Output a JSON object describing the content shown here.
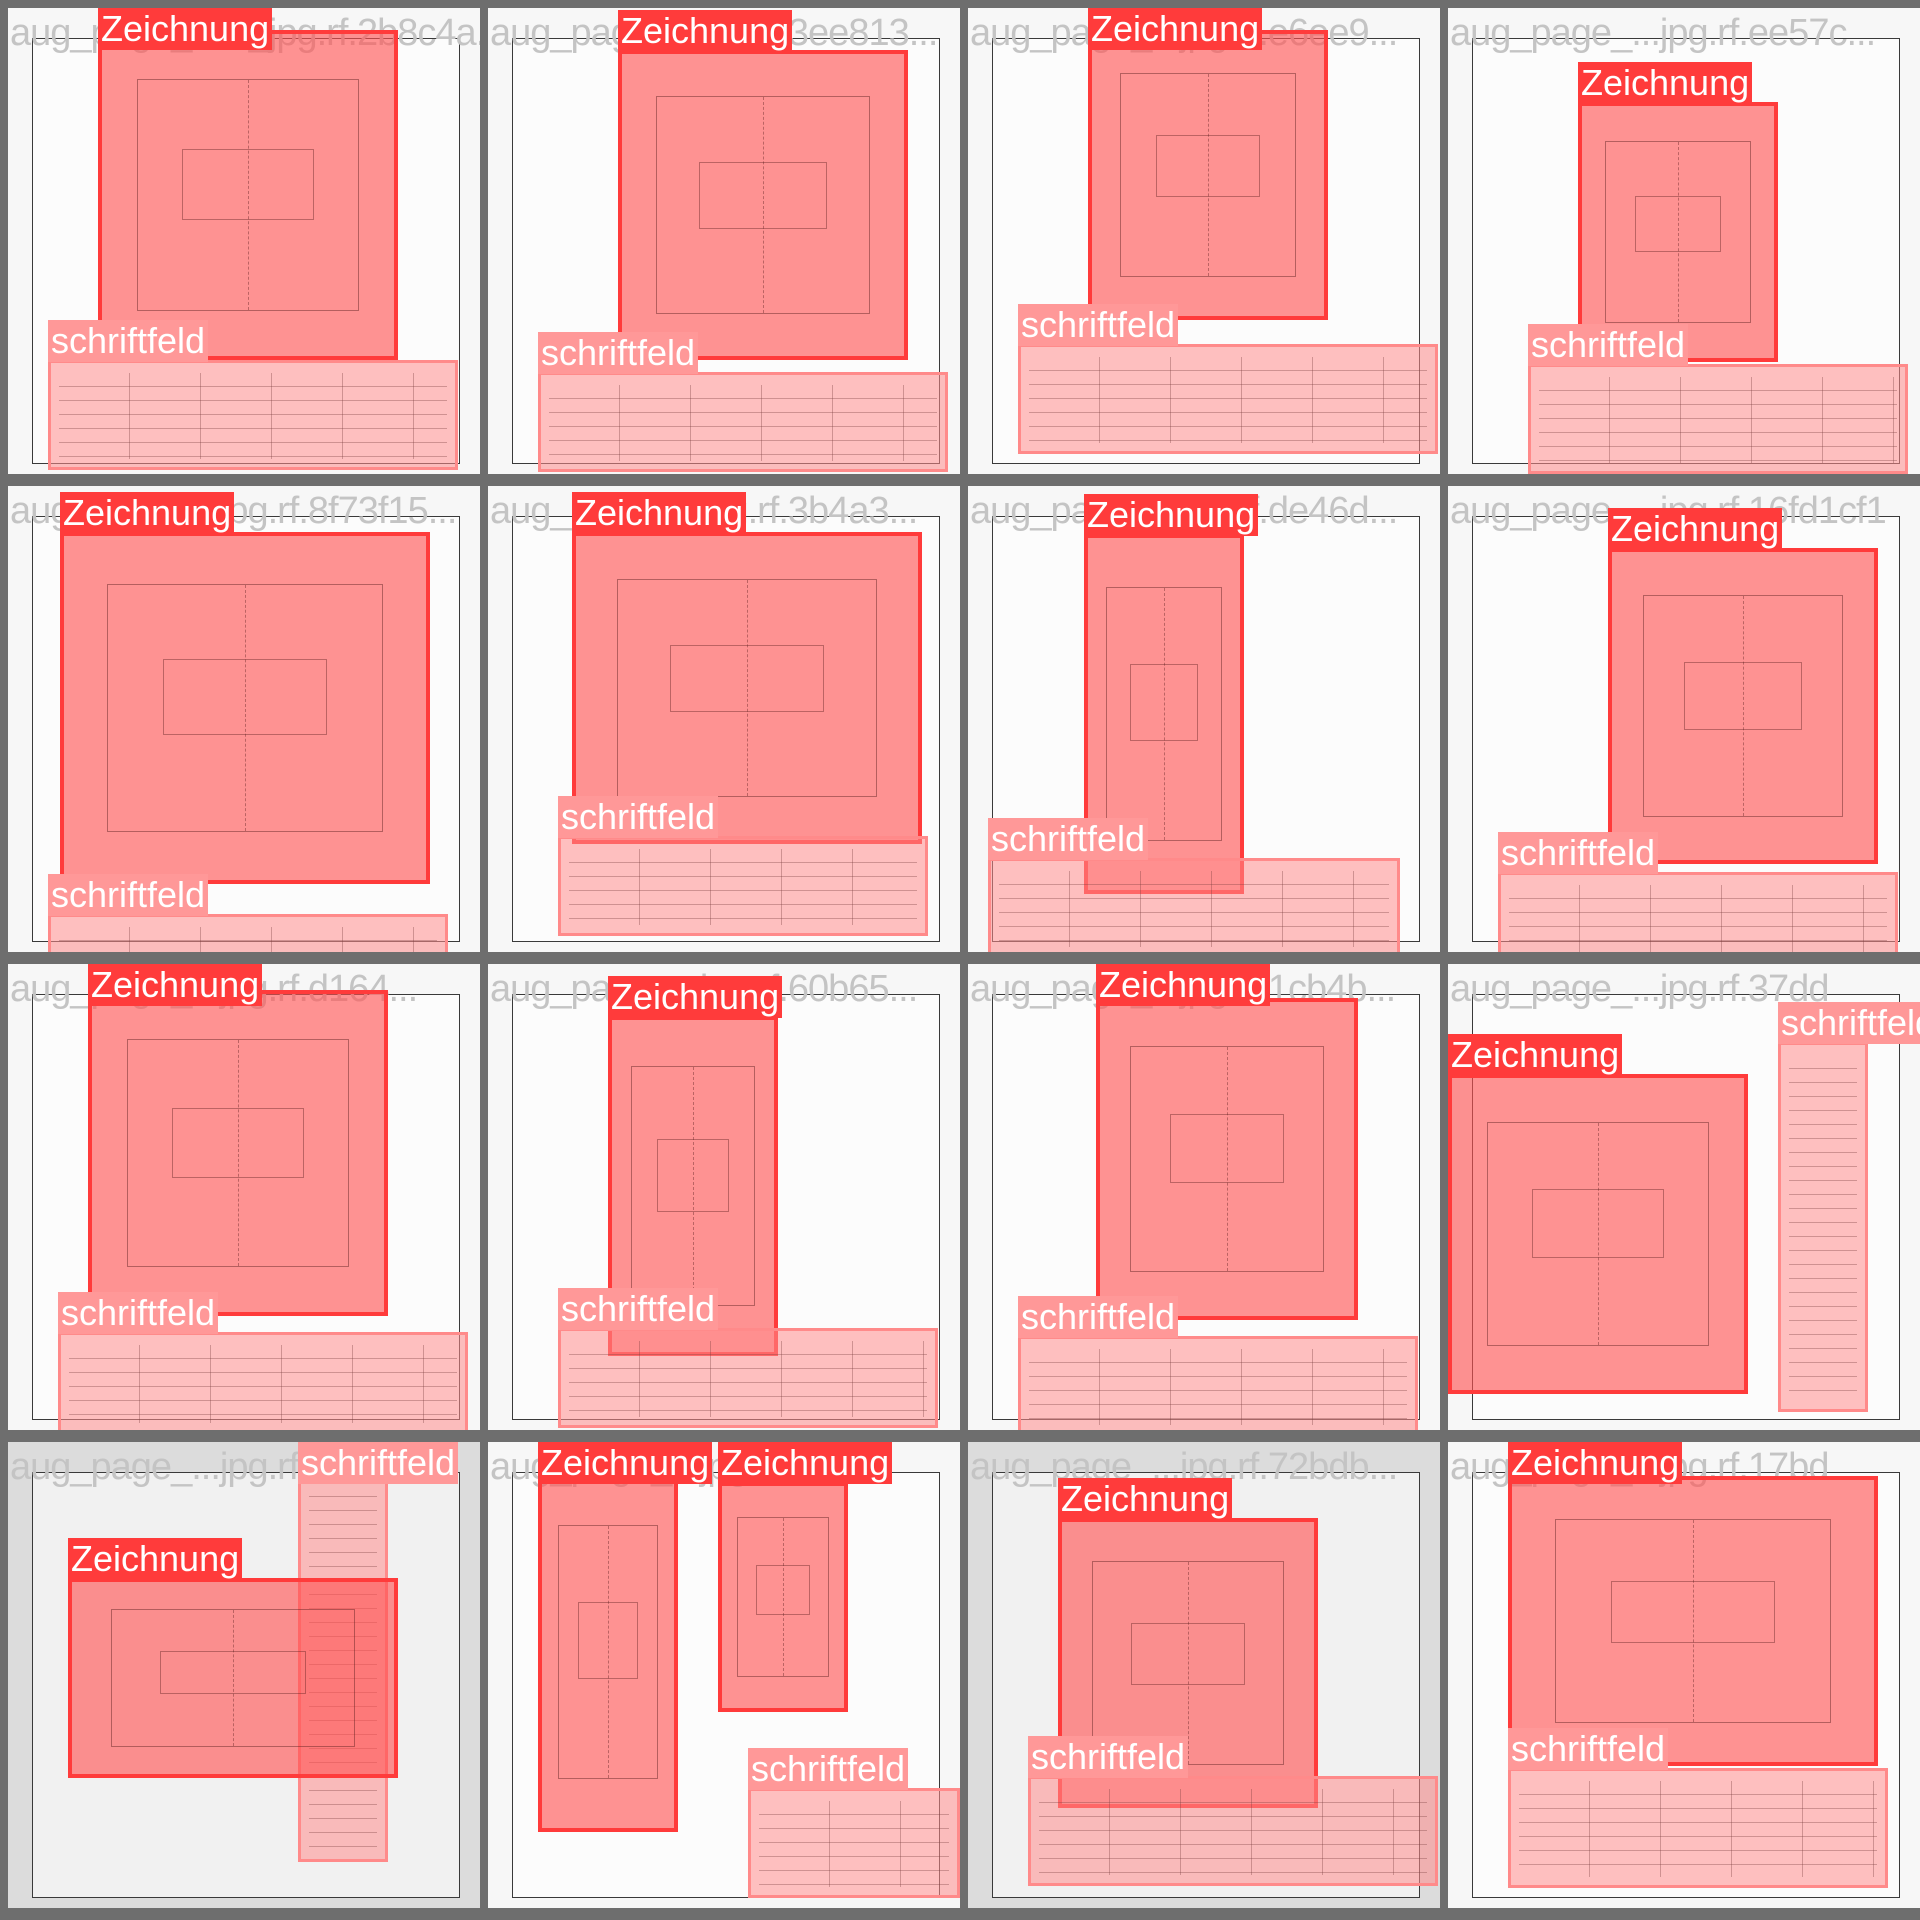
{
  "tiles": [
    {
      "fname": "aug_page_116_jpg.rf.2b8c4a...",
      "boxes": [
        {
          "cls": "z",
          "label": "Zeichnung"
        },
        {
          "cls": "s",
          "label": "schriftfeld"
        }
      ]
    },
    {
      "fname": "aug_page_...jpg.rf.3ee813...",
      "boxes": [
        {
          "cls": "z",
          "label": "Zeichnung"
        },
        {
          "cls": "s",
          "label": "schriftfeld"
        }
      ]
    },
    {
      "fname": "aug_page_...jpg.rf.e6ee9...",
      "boxes": [
        {
          "cls": "z",
          "label": "Zeichnung"
        },
        {
          "cls": "s",
          "label": "schriftfeld"
        }
      ]
    },
    {
      "fname": "aug_page_...jpg.rf.ee57c...",
      "boxes": [
        {
          "cls": "z",
          "label": "Zeichnung"
        },
        {
          "cls": "s",
          "label": "schriftfeld"
        }
      ]
    },
    {
      "fname": "aug_page_...jpg.rf.8f73f15...",
      "boxes": [
        {
          "cls": "z",
          "label": "Zeichnung"
        },
        {
          "cls": "s",
          "label": "schriftfeld"
        }
      ]
    },
    {
      "fname": "aug_page_...jpg.rf.3b4a3...",
      "boxes": [
        {
          "cls": "z",
          "label": "Zeichnung"
        },
        {
          "cls": "s",
          "label": "schriftfeld"
        }
      ]
    },
    {
      "fname": "aug_page_...jpg.rf.de46d...",
      "boxes": [
        {
          "cls": "z",
          "label": "Zeichnung"
        },
        {
          "cls": "s",
          "label": "schriftfeld"
        }
      ]
    },
    {
      "fname": "aug_page_...jpg.rf.16fd1cf1",
      "boxes": [
        {
          "cls": "z",
          "label": "Zeichnung"
        },
        {
          "cls": "s",
          "label": "schriftfeld"
        }
      ]
    },
    {
      "fname": "aug_page_...jpg.rf.d164...",
      "boxes": [
        {
          "cls": "z",
          "label": "Zeichnung"
        },
        {
          "cls": "s",
          "label": "schriftfeld"
        }
      ]
    },
    {
      "fname": "aug_page_...jpg.rf.60b65...",
      "boxes": [
        {
          "cls": "z",
          "label": "Zeichnung"
        },
        {
          "cls": "s",
          "label": "schriftfeld"
        }
      ]
    },
    {
      "fname": "aug_page_...jpg.rf.1cb4b...",
      "boxes": [
        {
          "cls": "z",
          "label": "Zeichnung"
        },
        {
          "cls": "s",
          "label": "schriftfeld"
        }
      ]
    },
    {
      "fname": "aug_page_...jpg.rf.37dd",
      "boxes": [
        {
          "cls": "s",
          "label": "schriftfeld"
        },
        {
          "cls": "z",
          "label": "Zeichnung"
        }
      ]
    },
    {
      "fname": "aug_page_...jpg.rf...",
      "boxes": [
        {
          "cls": "s",
          "label": "schriftfeld"
        },
        {
          "cls": "z",
          "label": "Zeichnung"
        }
      ]
    },
    {
      "fname": "aug_page_...jpg.rf...",
      "boxes": [
        {
          "cls": "z",
          "label": "Zeichnung"
        },
        {
          "cls": "z",
          "label": "Zeichnung"
        },
        {
          "cls": "s",
          "label": "schriftfeld"
        }
      ]
    },
    {
      "fname": "aug_page_...jpg.rf.72bdb...",
      "boxes": [
        {
          "cls": "z",
          "label": "Zeichnung"
        },
        {
          "cls": "s",
          "label": "schriftfeld"
        }
      ]
    },
    {
      "fname": "aug_page_...jpg.rf.17bd",
      "boxes": [
        {
          "cls": "z",
          "label": "Zeichnung"
        },
        {
          "cls": "s",
          "label": "schriftfeld"
        }
      ]
    }
  ],
  "colors": {
    "zeichnung": "#ff3b3b",
    "schriftfeld": "#ff9898",
    "background": "#6e6e6e"
  }
}
